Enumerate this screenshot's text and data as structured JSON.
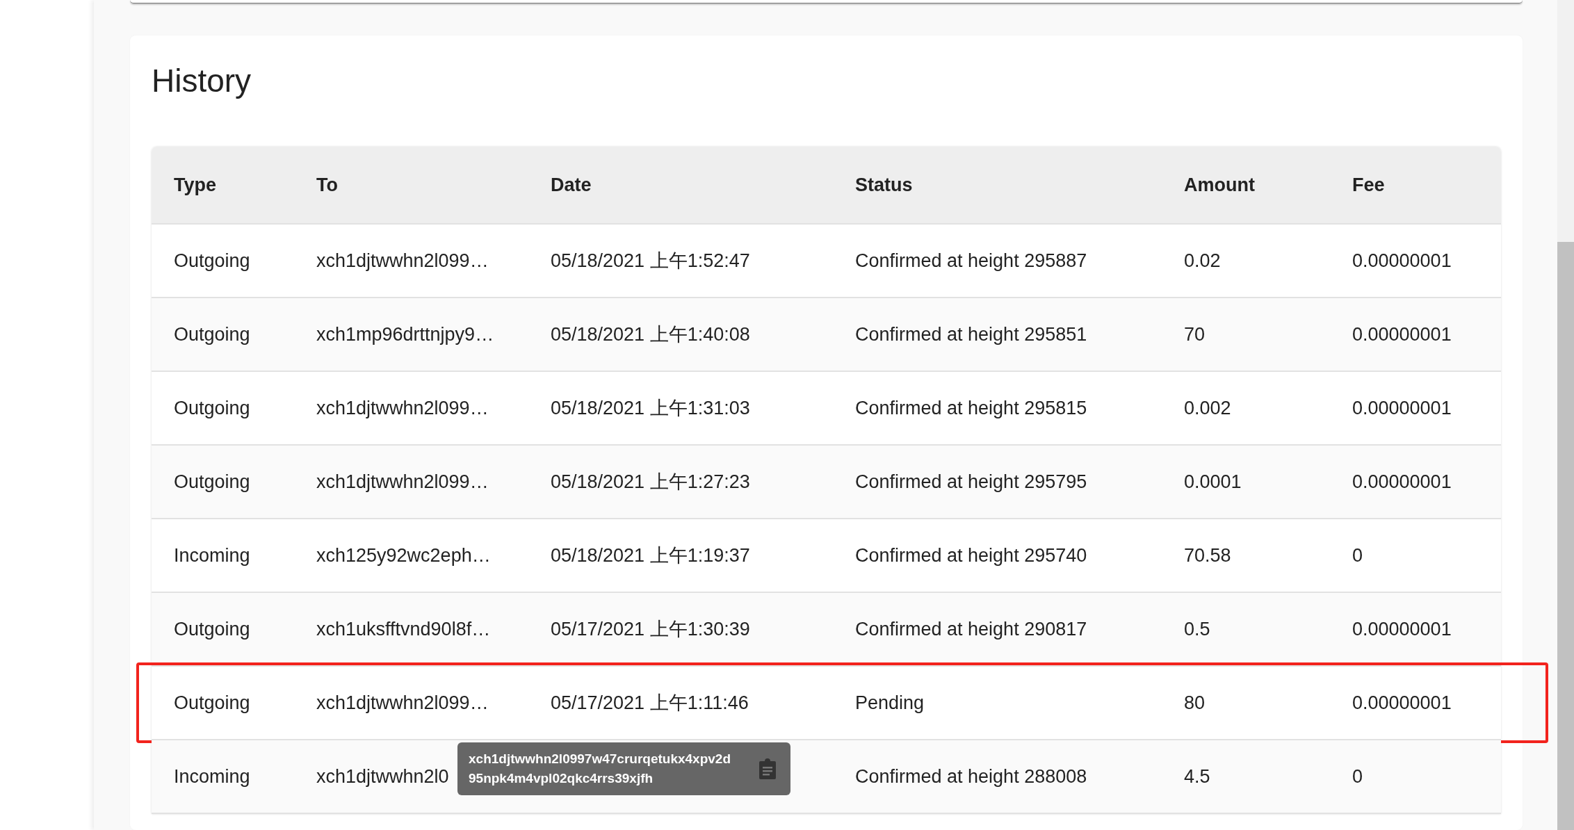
{
  "history": {
    "title": "History",
    "columns": [
      "Type",
      "To",
      "Date",
      "Status",
      "Amount",
      "Fee"
    ],
    "rows": [
      {
        "type": "Outgoing",
        "to": "xch1djtwwhn2l099…",
        "date": "05/18/2021 上午1:52:47",
        "status": "Confirmed at height 295887",
        "amount": "0.02",
        "fee": "0.00000001",
        "highlighted": false
      },
      {
        "type": "Outgoing",
        "to": "xch1mp96drttnjpy9…",
        "date": "05/18/2021 上午1:40:08",
        "status": "Confirmed at height 295851",
        "amount": "70",
        "fee": "0.00000001",
        "highlighted": false
      },
      {
        "type": "Outgoing",
        "to": "xch1djtwwhn2l099…",
        "date": "05/18/2021 上午1:31:03",
        "status": "Confirmed at height 295815",
        "amount": "0.002",
        "fee": "0.00000001",
        "highlighted": false
      },
      {
        "type": "Outgoing",
        "to": "xch1djtwwhn2l099…",
        "date": "05/18/2021 上午1:27:23",
        "status": "Confirmed at height 295795",
        "amount": "0.0001",
        "fee": "0.00000001",
        "highlighted": false
      },
      {
        "type": "Incoming",
        "to": "xch125y92wc2eph…",
        "date": "05/18/2021 上午1:19:37",
        "status": "Confirmed at height 295740",
        "amount": "70.58",
        "fee": "0",
        "highlighted": false
      },
      {
        "type": "Outgoing",
        "to": "xch1uksfftvnd90l8f…",
        "date": "05/17/2021 上午1:30:39",
        "status": "Confirmed at height 290817",
        "amount": "0.5",
        "fee": "0.00000001",
        "highlighted": false
      },
      {
        "type": "Outgoing",
        "to": "xch1djtwwhn2l099…",
        "date": "05/17/2021 上午1:11:46",
        "status": "Pending",
        "amount": "80",
        "fee": "0.00000001",
        "highlighted": true,
        "tooltip": {
          "lines": [
            "xch1djtwwhn2l0997w47crurqetukx4xpv2d",
            "95npk4m4vpl02qkc4rrs39xjfh"
          ]
        }
      },
      {
        "type": "Incoming",
        "to": "xch1djtwwhn2l0",
        "status": "Confirmed at height 288008",
        "amount": "4.5",
        "fee": "0",
        "highlighted": false
      }
    ]
  }
}
